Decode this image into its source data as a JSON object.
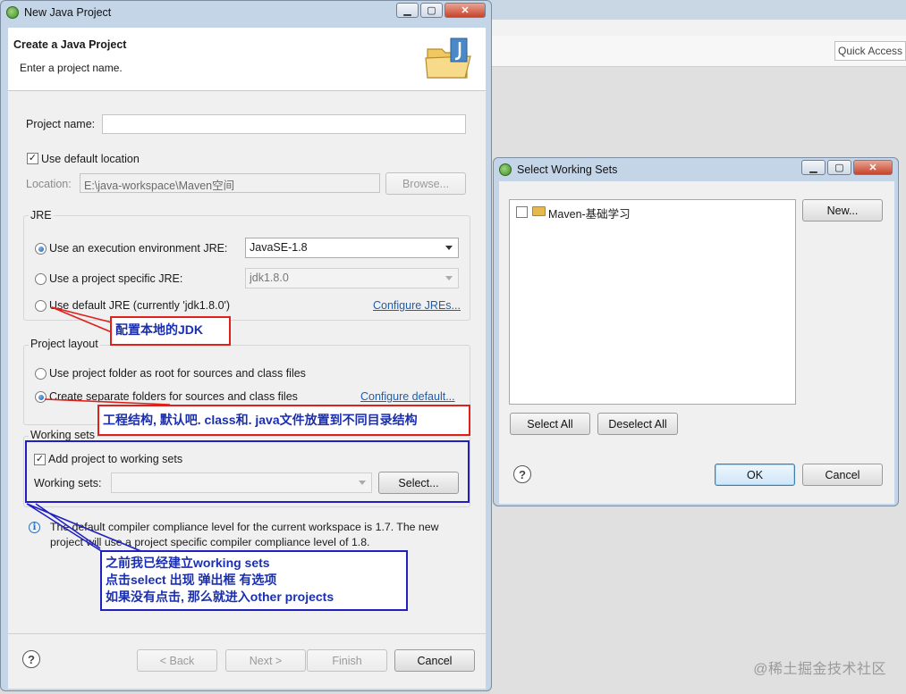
{
  "background": {
    "quick_access": "Quick Access",
    "watermark": "@稀土掘金技术社区"
  },
  "java_dialog": {
    "window_title": "New Java Project",
    "header_title": "Create a Java Project",
    "header_message": "Enter a project name.",
    "project_name_label": "Project name:",
    "project_name_value": "",
    "use_default_location_label": "Use default location",
    "use_default_location_checked": true,
    "location_label": "Location:",
    "location_value": "E:\\java-workspace\\Maven空间",
    "browse_label": "Browse...",
    "jre": {
      "group_label": "JRE",
      "option_env_label": "Use an execution environment JRE:",
      "option_env_value": "JavaSE-1.8",
      "option_specific_label": "Use a project specific JRE:",
      "option_specific_value": "jdk1.8.0",
      "option_default_label": "Use default JRE (currently 'jdk1.8.0')",
      "configure_link": "Configure JREs..."
    },
    "layout": {
      "group_label": "Project layout",
      "option_root_label": "Use project folder as root for sources and class files",
      "option_separate_label": "Create separate folders for sources and class files",
      "configure_link": "Configure default..."
    },
    "working_sets": {
      "group_label": "Working sets",
      "add_label": "Add project to working sets",
      "add_checked": true,
      "combo_label": "Working sets:",
      "combo_value": "",
      "select_label": "Select..."
    },
    "info_line1": "The default compiler compliance level for the current workspace is 1.7. The new",
    "info_line2": "project will use a project specific compiler compliance level of 1.8.",
    "buttons": {
      "back": "< Back",
      "next": "Next >",
      "finish": "Finish",
      "cancel": "Cancel"
    }
  },
  "callouts": {
    "jdk": "配置本地的JDK",
    "layout": "工程结构, 默认吧. class和. java文件放置到不同目录结构",
    "ws_line1": "之前我已经建立working sets",
    "ws_line2": "点击select  出现  弹出框  有选项",
    "ws_line3": "如果没有点击, 那么就进入other  projects"
  },
  "ws_dialog": {
    "window_title": "Select Working Sets",
    "items": [
      {
        "label": "Maven-基础学习",
        "checked": false
      }
    ],
    "new_label": "New...",
    "select_all_label": "Select All",
    "deselect_all_label": "Deselect All",
    "ok_label": "OK",
    "cancel_label": "Cancel"
  },
  "colors": {
    "callout_red": "#e0201a",
    "callout_blue": "#2020c0",
    "callout_text": "#1a2fb0",
    "link": "#1b5fb3"
  }
}
